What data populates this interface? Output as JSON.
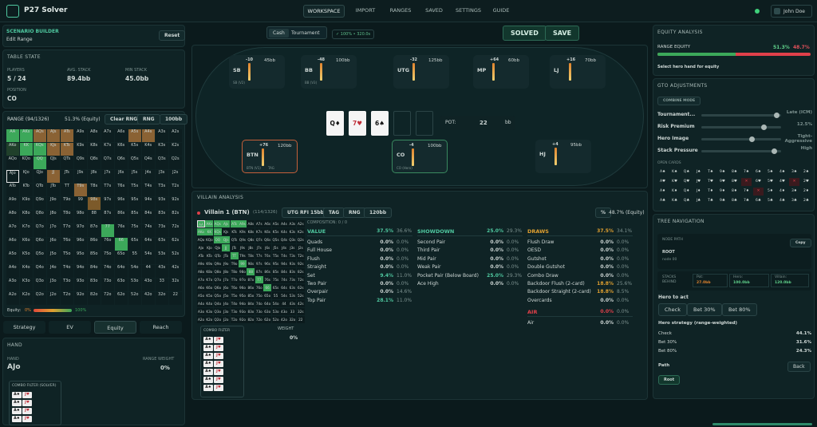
{
  "app": {
    "title": "P27 Solver"
  },
  "nav": {
    "items": [
      "WORKSPACE",
      "IMPORT",
      "RANGES",
      "SAVED",
      "SETTINGS",
      "GUIDE"
    ],
    "active": 0
  },
  "user": {
    "name": "John Doe"
  },
  "scenario": {
    "title": "SCENARIO BUILDER",
    "subtitle": "Edit Range",
    "reset": "Reset"
  },
  "table_state": {
    "title": "TABLE STATE",
    "players_label": "PLAYERS",
    "players": "5 / 24",
    "avg_label": "AVG. STACK",
    "avg": "89.4bb",
    "min_label": "MIN STACK",
    "min": "45.0bb",
    "position_label": "POSITION",
    "position": "CO"
  },
  "range": {
    "label": "RANGE (94/1326)",
    "equity": "51.3% (Equity)",
    "buttons": [
      "Clear RNG",
      "RNG",
      "100bb"
    ],
    "equity_bar_label": "Equity:",
    "equity_lo": "0%",
    "equity_hi": "100%"
  },
  "tabs_left": [
    "Strategy",
    "EV",
    "Equity",
    "Reach"
  ],
  "tabs_left_active": 2,
  "hand_panel": {
    "title": "HAND",
    "hand_label": "HAND",
    "hand": "AJo",
    "weight_label": "RANGE WEIGHT",
    "weight": "0%",
    "filter_label": "COMBO FILTER (SOLVER)"
  },
  "mode": {
    "cash": "Cash",
    "tournament": "Tournament",
    "status": "✓ 100% • 320.0s"
  },
  "actions": {
    "solved": "SOLVED",
    "save": "SAVE"
  },
  "seats": [
    {
      "pos": "SB",
      "val": "-10",
      "stack": "45bb",
      "tag": "SB (V2)"
    },
    {
      "pos": "BB",
      "val": "-48",
      "stack": "100bb",
      "tag": "BB (V3)"
    },
    {
      "pos": "UTG",
      "val": "-32",
      "stack": "125bb",
      "tag": ""
    },
    {
      "pos": "MP",
      "val": "+64",
      "stack": "60bb",
      "tag": ""
    },
    {
      "pos": "LJ",
      "val": "+16",
      "stack": "70bb",
      "tag": ""
    },
    {
      "pos": "BTN",
      "val": "+76",
      "stack": "120bb",
      "tag": "BTN (V1)",
      "tag2": "TAG"
    },
    {
      "pos": "CO",
      "val": "-4",
      "stack": "100bb",
      "tag": "CO (Hero)"
    },
    {
      "pos": "HJ",
      "val": "+4",
      "stack": "95bb",
      "tag": ""
    }
  ],
  "board": {
    "cards": [
      "Q♦",
      "7♥",
      "6♠"
    ],
    "pot_label": "POT:",
    "pot": "22",
    "pot_unit": "bb"
  },
  "villain": {
    "title": "VILLAIN ANALYSIS",
    "name": "Villain 1 (BTN)",
    "count": "(114/1326)",
    "tags": [
      "UTG RFI 15bb",
      "TAG",
      "RNG",
      "120bb"
    ],
    "equity_btn": "%",
    "equity": "48.7% (Equity)",
    "composition": "COMPOSITION: 0 / 0",
    "combo_filter": "COMBO FILTER",
    "weight_label": "WEIGHT",
    "weight": "0%"
  },
  "composition": {
    "value": {
      "title": "VALUE",
      "pct": "37.5%",
      "pct2": "36.6%",
      "rows": [
        [
          "Quads",
          "0.0%",
          "0.0%"
        ],
        [
          "Full House",
          "0.0%",
          "0.0%"
        ],
        [
          "Flush",
          "0.0%",
          "0.0%"
        ],
        [
          "Straight",
          "0.0%",
          "0.0%"
        ],
        [
          "Set",
          "9.4%",
          "11.0%"
        ],
        [
          "Two Pair",
          "0.0%",
          "0.0%"
        ],
        [
          "Overpair",
          "0.0%",
          "14.6%"
        ],
        [
          "Top Pair",
          "28.1%",
          "11.0%"
        ]
      ]
    },
    "showdown": {
      "title": "SHOWDOWN",
      "pct": "25.0%",
      "pct2": "29.3%",
      "rows": [
        [
          "Second Pair",
          "0.0%",
          "0.0%"
        ],
        [
          "Third Pair",
          "0.0%",
          "0.0%"
        ],
        [
          "Mid Pair",
          "0.0%",
          "0.0%"
        ],
        [
          "Weak Pair",
          "0.0%",
          "0.0%"
        ],
        [
          "Pocket Pair (Below Board)",
          "25.0%",
          "29.3%"
        ],
        [
          "Ace High",
          "0.0%",
          "0.0%"
        ]
      ]
    },
    "draws": {
      "title": "DRAWS",
      "pct": "37.5%",
      "pct2": "34.1%",
      "rows": [
        [
          "Flush Draw",
          "0.0%",
          "0.0%"
        ],
        [
          "OESD",
          "0.0%",
          "0.0%"
        ],
        [
          "Gutshot",
          "0.0%",
          "0.0%"
        ],
        [
          "Double Gutshot",
          "0.0%",
          "0.0%"
        ],
        [
          "Combo Draw",
          "0.0%",
          "0.0%"
        ],
        [
          "Backdoor Flush (2-card)",
          "18.8%",
          "25.6%"
        ],
        [
          "Backdoor Straight (2-card)",
          "18.8%",
          "8.5%"
        ],
        [
          "Overcards",
          "0.0%",
          "0.0%"
        ]
      ]
    },
    "air": {
      "title": "AIR",
      "pct": "0.0%",
      "pct2": "0.0%",
      "rows": [
        [
          "Air",
          "0.0%",
          "0.0%"
        ]
      ]
    }
  },
  "equity_analysis": {
    "title": "EQUITY ANALYSIS",
    "label": "RANGE EQUITY",
    "hero": "51.3%",
    "villain": "48.7%",
    "note": "Select hero hand for equity"
  },
  "gto": {
    "title": "GTO ADJUSTMENTS",
    "chip": "COMBINE MODE",
    "sliders": [
      {
        "label": "Tournament...",
        "value": "Late (ICM)",
        "level": 0.95
      },
      {
        "label": "Risk Premium",
        "value": "12.5%",
        "level": 0.78
      },
      {
        "label": "Hero Image",
        "value": "Tight-Aggressive",
        "level": 0.62
      },
      {
        "label": "Stack Pressure",
        "value": "High",
        "level": 0.92
      }
    ],
    "open_cards": "OPEN CARDS"
  },
  "tree": {
    "title": "TREE NAVIGATION",
    "node_path": "NODE PATH",
    "copy": "Copy",
    "root": "ROOT",
    "node": "node 00",
    "stacks_label": "STACKS BEHIND",
    "pot_l": "Pot:",
    "pot": "27.0bb",
    "hero_l": "Hero:",
    "hero": "100.0bb",
    "villain_l": "Villain:",
    "villain": "120.0bb",
    "hero_to_act": "Hero to act",
    "options": [
      "Check",
      "Bet 30%",
      "Bet 80%"
    ],
    "strategy_title": "Hero strategy (range-weighted)",
    "strategy": [
      [
        "Check",
        "44.1%"
      ],
      [
        "Bet 30%",
        "31.6%"
      ],
      [
        "Bet 80%",
        "24.3%"
      ]
    ],
    "path_label": "Path",
    "back": "Back",
    "root_btn": "Root"
  },
  "colors": {
    "bg": "#0b1a1c",
    "green": "#3ca85a",
    "brown": "#8a6234",
    "orange": "#e0832e",
    "red": "#e0404a"
  }
}
